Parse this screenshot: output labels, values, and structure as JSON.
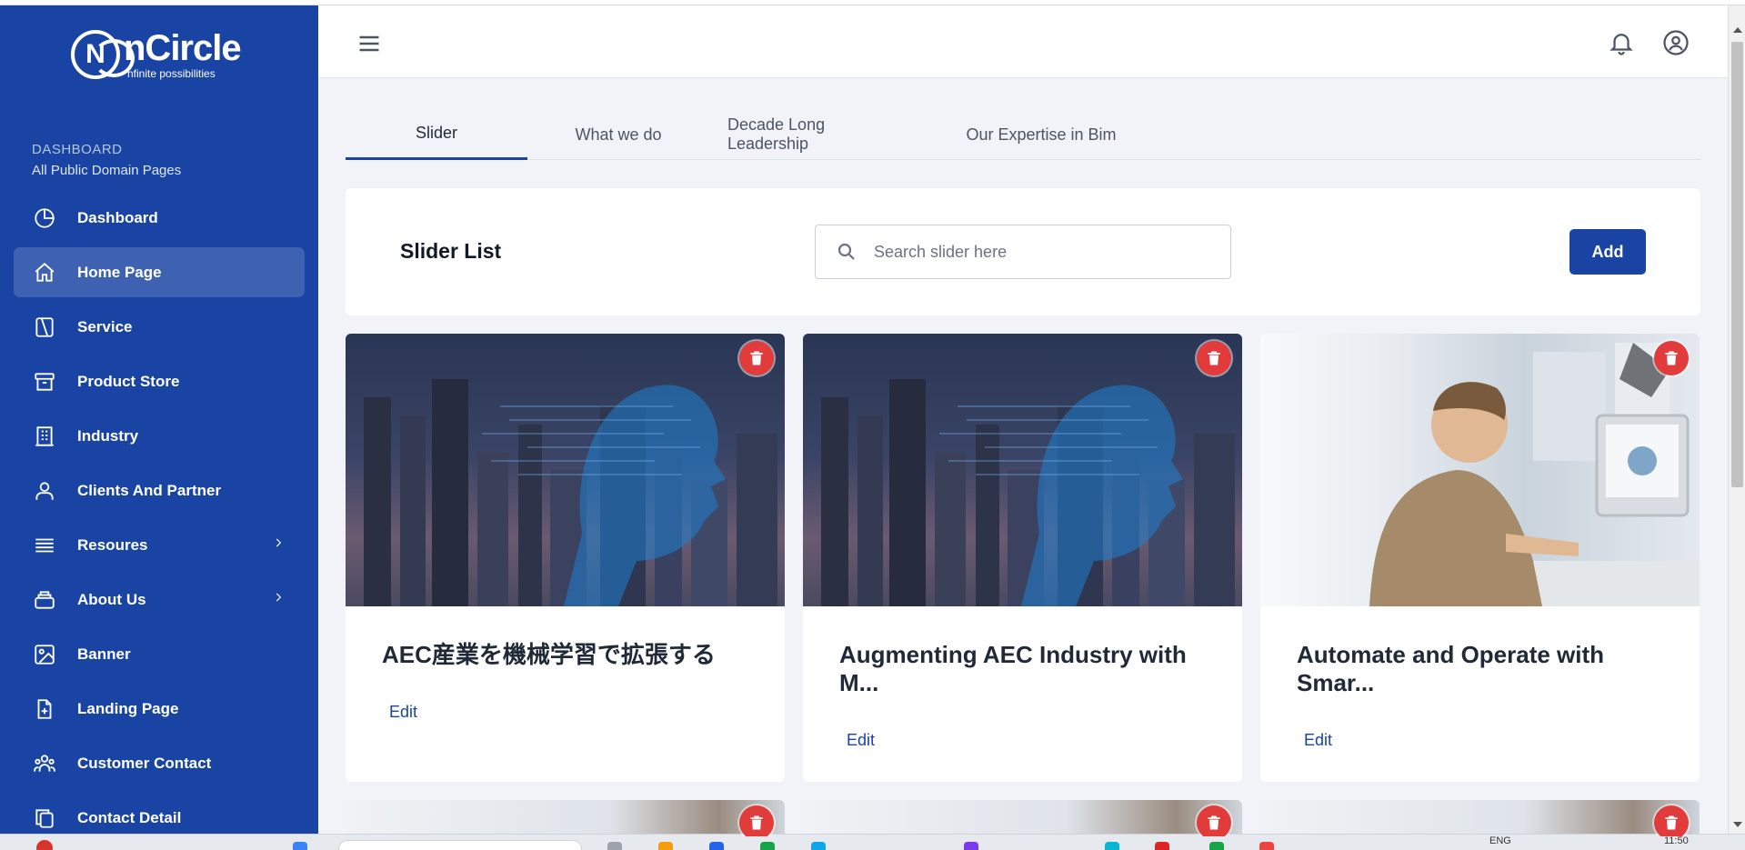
{
  "brand": {
    "name": "nCircle",
    "tagline": "nfinite possibilities",
    "mark": "N"
  },
  "sidebar": {
    "section_title": "DASHBOARD",
    "section_subtitle": "All Public Domain Pages",
    "items": [
      {
        "label": "Dashboard",
        "icon": "pie-chart-icon",
        "active": false,
        "has_submenu": false
      },
      {
        "label": "Home Page",
        "icon": "home-icon",
        "active": true,
        "has_submenu": false
      },
      {
        "label": "Service",
        "icon": "service-icon",
        "active": false,
        "has_submenu": false
      },
      {
        "label": "Product Store",
        "icon": "archive-box-icon",
        "active": false,
        "has_submenu": false
      },
      {
        "label": "Industry",
        "icon": "building-icon",
        "active": false,
        "has_submenu": false
      },
      {
        "label": "Clients And Partner",
        "icon": "users-icon",
        "active": false,
        "has_submenu": false
      },
      {
        "label": "Resoures",
        "icon": "list-icon",
        "active": false,
        "has_submenu": true
      },
      {
        "label": "About Us",
        "icon": "stack-icon",
        "active": false,
        "has_submenu": true
      },
      {
        "label": "Banner",
        "icon": "image-icon",
        "active": false,
        "has_submenu": false
      },
      {
        "label": "Landing Page",
        "icon": "file-plus-icon",
        "active": false,
        "has_submenu": false
      },
      {
        "label": "Customer Contact",
        "icon": "group-icon",
        "active": false,
        "has_submenu": false
      },
      {
        "label": "Contact Detail",
        "icon": "copy-icon",
        "active": false,
        "has_submenu": false
      }
    ]
  },
  "header": {
    "menu_icon": "hamburger-icon",
    "notification_icon": "bell-icon",
    "profile_icon": "user-circle-icon"
  },
  "tabs": [
    {
      "label": "Slider",
      "active": true
    },
    {
      "label": "What we do",
      "active": false
    },
    {
      "label": "Decade Long Leadership",
      "active": false
    },
    {
      "label": "Our Expertise in Bim",
      "active": false
    }
  ],
  "slider_list": {
    "title": "Slider List",
    "search_placeholder": "Search slider here",
    "add_label": "Add"
  },
  "cards": [
    {
      "title": "AEC産業を機械学習で拡張する",
      "edit_label": "Edit",
      "image": "city-skyline-ai-head"
    },
    {
      "title": "Augmenting AEC Industry with M...",
      "edit_label": "Edit",
      "image": "city-skyline-ai-head"
    },
    {
      "title": "Automate and Operate with Smar...",
      "edit_label": "Edit",
      "image": "man-at-computer-office"
    }
  ],
  "taskbar": {
    "language": "ENG",
    "time": "11:50"
  },
  "colors": {
    "sidebar_bg": "#1a44a3",
    "accent": "#1a44a3",
    "delete": "#e23b3b",
    "page_bg": "#f1f3f8"
  }
}
